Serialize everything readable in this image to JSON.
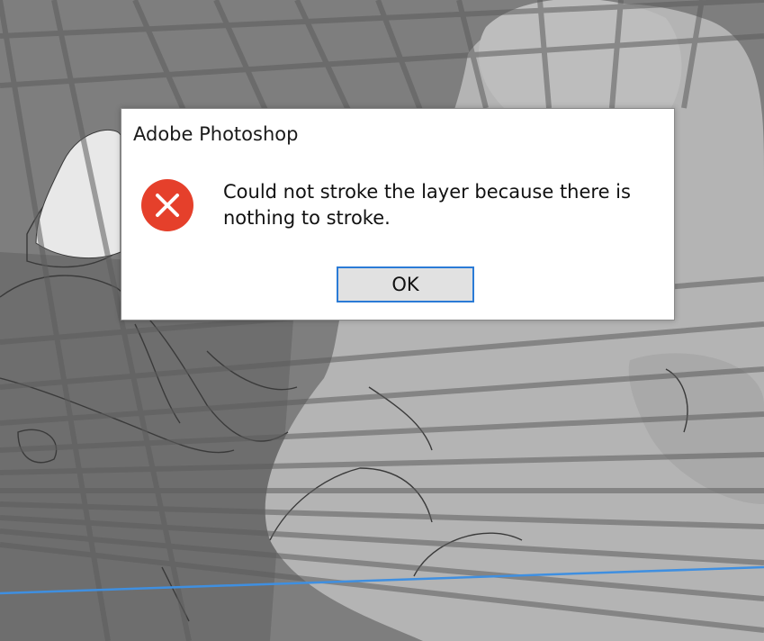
{
  "dialog": {
    "title": "Adobe Photoshop",
    "message": "Could not stroke the layer because there is nothing to stroke.",
    "ok_label": "OK",
    "icon": "error-icon"
  },
  "colors": {
    "error_red": "#e5402b",
    "focus_blue": "#2b7bd6",
    "button_face": "#e1e1e1",
    "guide_line": "#3f8fe0"
  }
}
